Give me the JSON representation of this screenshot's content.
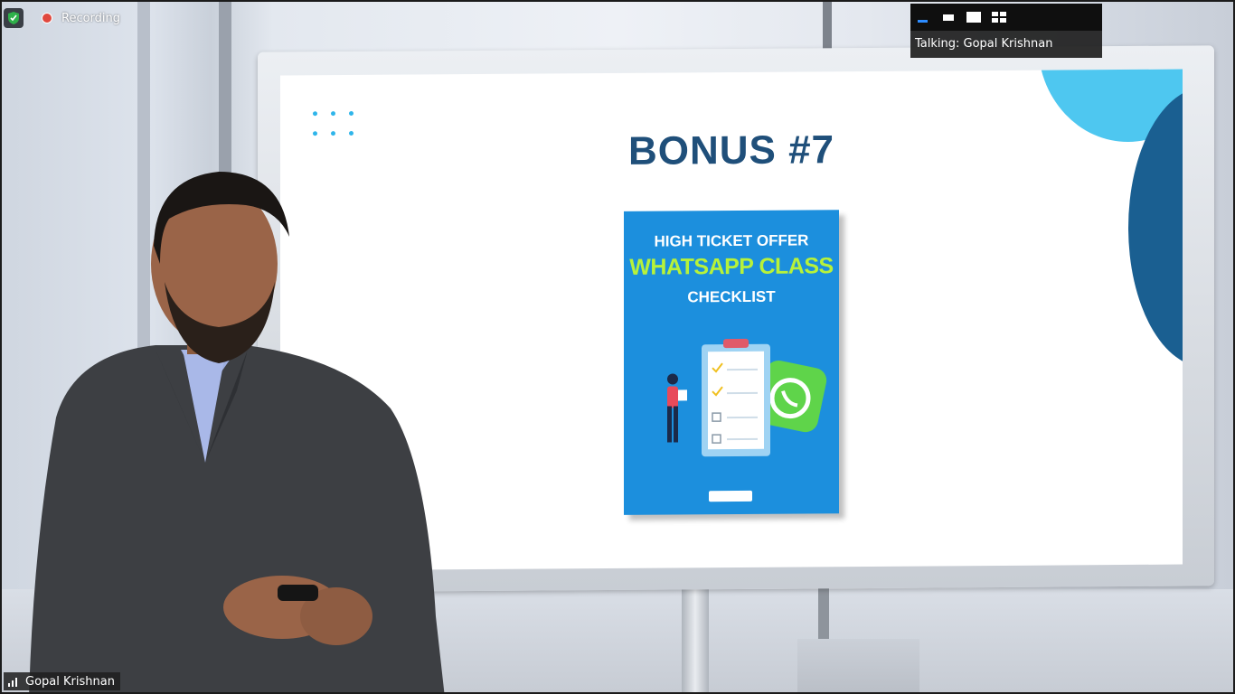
{
  "recording": {
    "label": "Recording",
    "shield_icon": "shield-check-icon",
    "dot_color": "#e0483e"
  },
  "view_controls": {
    "items": [
      {
        "name": "minimize-view",
        "icon": "minimize-icon"
      },
      {
        "name": "thumbnail-view",
        "icon": "thumbnail-icon"
      },
      {
        "name": "speaker-view",
        "icon": "speaker-view-icon"
      },
      {
        "name": "gallery-view",
        "icon": "gallery-grid-icon"
      }
    ]
  },
  "talking_indicator": {
    "text": "Talking: Gopal Krishnan"
  },
  "participant": {
    "name": "Gopal Krishnan",
    "signal_icon": "signal-bars-icon"
  },
  "slide": {
    "title": "BONUS #7",
    "title_color": "#1f4f7a",
    "accent_light": "#4ec7f0",
    "accent_dark": "#1a5f91",
    "cover": {
      "line1": "HIGH TICKET OFFER",
      "line2": "WHATSAPP CLASS",
      "line3": "CHECKLIST",
      "background": "#1c8fdd",
      "highlight": "#b7f23a",
      "art_icons": [
        "checklist-clipboard-icon",
        "whatsapp-icon",
        "person-figure-icon"
      ],
      "logo_icon": "brand-logo-icon"
    }
  }
}
